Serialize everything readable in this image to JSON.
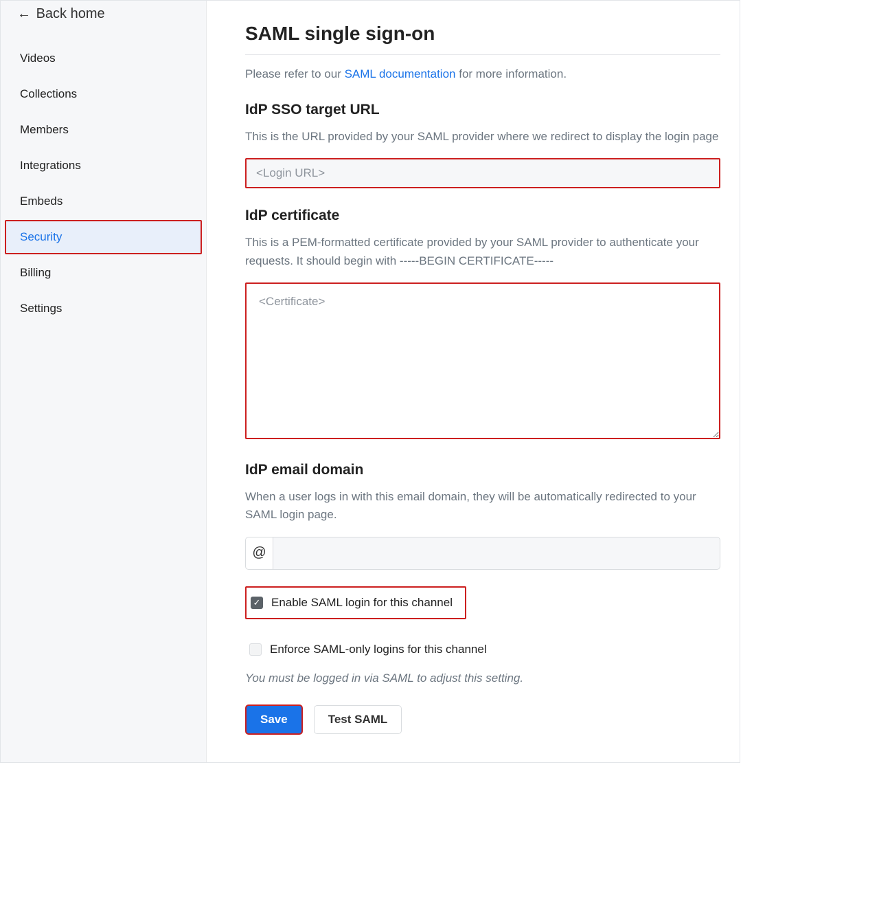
{
  "sidebar": {
    "back_label": "Back home",
    "items": [
      {
        "label": "Videos"
      },
      {
        "label": "Collections"
      },
      {
        "label": "Members"
      },
      {
        "label": "Integrations"
      },
      {
        "label": "Embeds"
      },
      {
        "label": "Security"
      },
      {
        "label": "Billing"
      },
      {
        "label": "Settings"
      }
    ],
    "active_index": 5
  },
  "main": {
    "title": "SAML single sign-on",
    "intro_before": "Please refer to our ",
    "intro_link": "SAML documentation",
    "intro_after": " for more information.",
    "idp_url": {
      "heading": "IdP SSO target URL",
      "desc": "This is the URL provided by your SAML provider where we redirect to display the login page",
      "placeholder": "<Login URL>",
      "value": ""
    },
    "idp_cert": {
      "heading": "IdP certificate",
      "desc": "This is a PEM-formatted certificate provided by your SAML provider to authenticate your requests. It should begin with -----BEGIN CERTIFICATE-----",
      "placeholder": "<Certificate>",
      "value": ""
    },
    "idp_email": {
      "heading": "IdP email domain",
      "desc": "When a user logs in with this email domain, they will be automatically redirected to your SAML login page.",
      "prefix": "@",
      "value": ""
    },
    "enable_saml": {
      "label": "Enable SAML login for this channel",
      "checked": true
    },
    "enforce_saml": {
      "label": "Enforce SAML-only logins for this channel",
      "checked": false,
      "note": "You must be logged in via SAML to adjust this setting."
    },
    "buttons": {
      "save": "Save",
      "test": "Test SAML"
    }
  }
}
